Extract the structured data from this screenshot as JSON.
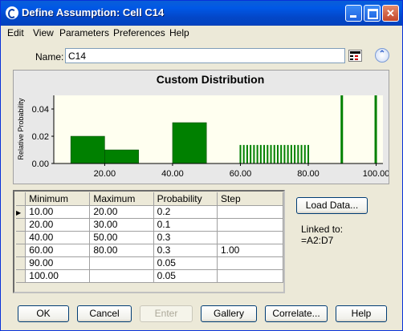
{
  "window": {
    "title": "Define Assumption: Cell C14"
  },
  "menu": [
    "Edit",
    "View",
    "Parameters",
    "Preferences",
    "Help"
  ],
  "name": {
    "label": "Name:",
    "value": "C14"
  },
  "chart_data": {
    "type": "bar",
    "title": "Custom Distribution",
    "ylabel": "Relative Probability",
    "xlabel": "",
    "xlim": [
      5,
      102
    ],
    "ylim": [
      0,
      0.05
    ],
    "yticks": [
      "0.00",
      "0.02",
      "0.04"
    ],
    "xticks": [
      "20.00",
      "40.00",
      "60.00",
      "80.00",
      "100.00"
    ],
    "bar_color": "#008000",
    "ranges": [
      {
        "min": 10,
        "max": 20,
        "height": 0.02
      },
      {
        "min": 20,
        "max": 30,
        "height": 0.01
      },
      {
        "min": 40,
        "max": 50,
        "height": 0.03
      }
    ],
    "discrete": {
      "step_start": 60,
      "step_end": 80,
      "step": 1,
      "step_height": 0.0136,
      "points": [
        {
          "x": 90,
          "height": 0.05
        },
        {
          "x": 100,
          "height": 0.05
        }
      ]
    }
  },
  "table": {
    "headers": [
      "Minimum",
      "Maximum",
      "Probability",
      "Step"
    ],
    "rows": [
      [
        "10.00",
        "20.00",
        "0.2",
        ""
      ],
      [
        "20.00",
        "30.00",
        "0.1",
        ""
      ],
      [
        "40.00",
        "50.00",
        "0.3",
        ""
      ],
      [
        "60.00",
        "80.00",
        "0.3",
        "1.00"
      ],
      [
        "90.00",
        "",
        "0.05",
        ""
      ],
      [
        "100.00",
        "",
        "0.05",
        ""
      ]
    ]
  },
  "load_data_label": "Load Data...",
  "linked": {
    "label": "Linked to:",
    "value": "=A2:D7"
  },
  "buttons": {
    "ok": "OK",
    "cancel": "Cancel",
    "enter": "Enter",
    "gallery": "Gallery",
    "correlate": "Correlate...",
    "help": "Help"
  }
}
